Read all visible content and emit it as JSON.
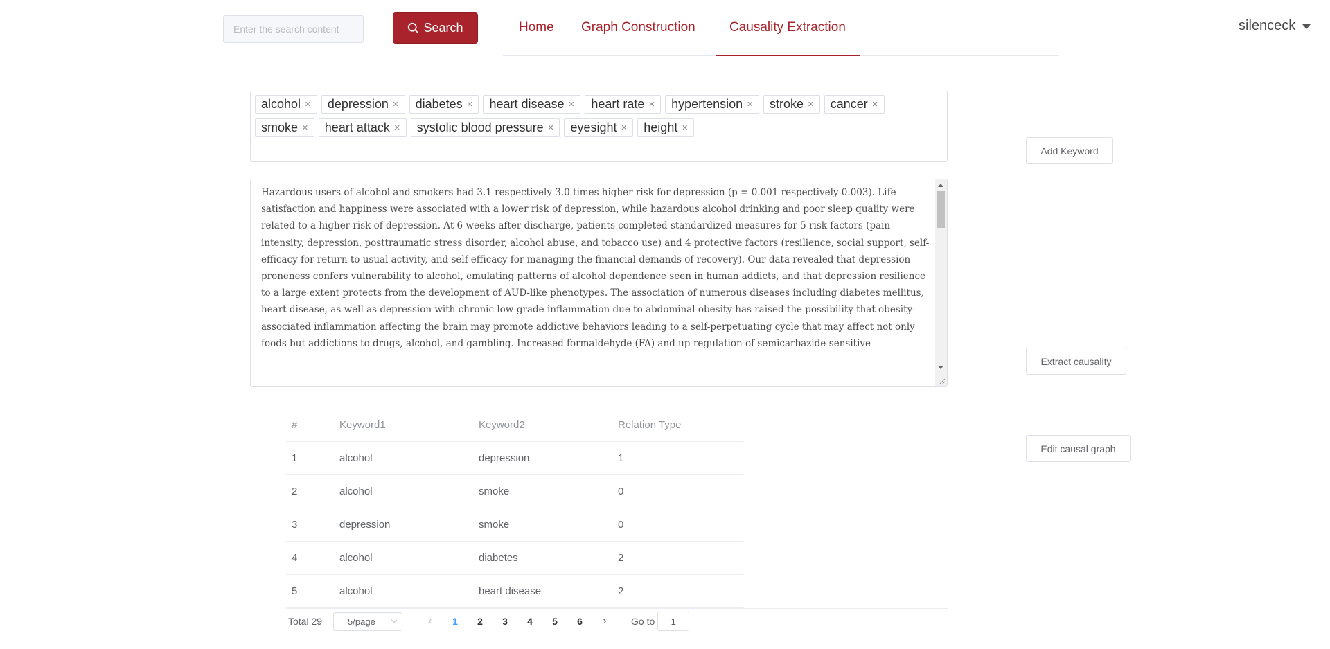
{
  "header": {
    "search_placeholder": "Enter the search content",
    "search_label": "Search",
    "nav": [
      {
        "label": "Home",
        "active": false
      },
      {
        "label": "Graph Construction",
        "active": false
      },
      {
        "label": "Causality Extraction",
        "active": true
      }
    ],
    "username": "silenceck"
  },
  "keywords": [
    "alcohol",
    "depression",
    "diabetes",
    "heart disease",
    "heart rate",
    "hypertension",
    "stroke",
    "cancer",
    "smoke",
    "heart attack",
    "systolic blood pressure",
    "eyesight",
    "height"
  ],
  "actions": {
    "add_keyword": "Add Keyword",
    "extract": "Extract causality",
    "edit_graph": "Edit causal graph"
  },
  "text_input": "Hazardous users of alcohol and smokers had 3.1 respectively 3.0 times higher risk for depression (p = 0.001 respectively 0.003). Life satisfaction and happiness were associated with a lower risk of depression, while hazardous alcohol drinking and poor sleep quality were related to a higher risk of depression. At 6 weeks after discharge, patients completed standardized measures for 5 risk factors (pain intensity, depression, posttraumatic stress disorder, alcohol abuse, and tobacco use) and 4 protective factors (resilience, social support, self-efficacy for return to usual activity, and self-efficacy for managing the financial demands of recovery). Our data revealed that depression proneness confers vulnerability to alcohol, emulating patterns of alcohol dependence seen in human addicts, and that depression resilience to a large extent protects from the development of AUD-like phenotypes. The association of numerous diseases including diabetes mellitus, heart disease, as well as depression with chronic low-grade inflammation due to abdominal obesity has raised the possibility that obesity-associated inflammation affecting the brain may promote addictive behaviors leading to a self-perpetuating cycle that may affect not only foods but addictions to drugs, alcohol, and gambling. Increased formaldehyde (FA) and up-regulation of semicarbazide-sensitive",
  "table": {
    "headers": [
      "#",
      "Keyword1",
      "Keyword2",
      "Relation Type"
    ],
    "rows": [
      {
        "index": "1",
        "k1": "alcohol",
        "k2": "depression",
        "type": "1"
      },
      {
        "index": "2",
        "k1": "alcohol",
        "k2": "smoke",
        "type": "0"
      },
      {
        "index": "3",
        "k1": "depression",
        "k2": "smoke",
        "type": "0"
      },
      {
        "index": "4",
        "k1": "alcohol",
        "k2": "diabetes",
        "type": "2"
      },
      {
        "index": "5",
        "k1": "alcohol",
        "k2": "heart disease",
        "type": "2"
      }
    ]
  },
  "pagination": {
    "total": "Total 29",
    "page_size": "5/page",
    "pages": [
      "1",
      "2",
      "3",
      "4",
      "5",
      "6"
    ],
    "current": "1",
    "goto_label": "Go to",
    "goto_value": "1"
  }
}
